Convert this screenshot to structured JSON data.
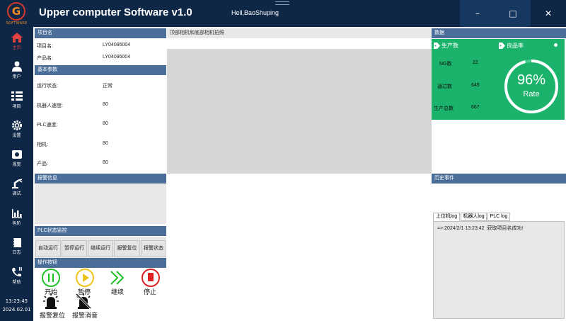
{
  "sidebar": {
    "logo_letter": "G",
    "logo_text": "SOFTWARE",
    "items": [
      {
        "label": "主页",
        "icon": "home-icon"
      },
      {
        "label": "用户",
        "icon": "user-icon"
      },
      {
        "label": "项目",
        "icon": "list-icon"
      },
      {
        "label": "设置",
        "icon": "gear-icon"
      },
      {
        "label": "视觉",
        "icon": "camera-icon"
      },
      {
        "label": "调试",
        "icon": "robot-arm-icon"
      },
      {
        "label": "色阶",
        "icon": "bar-chart-icon"
      },
      {
        "label": "日志",
        "icon": "log-icon"
      },
      {
        "label": "帮助",
        "icon": "phone-icon"
      }
    ],
    "time": "13:23:45",
    "date": "2024.02.01"
  },
  "titlebar": {
    "title": "Upper computer Software v1.0",
    "user": "Hell,BaoShuping",
    "min_label": "–",
    "max_label": "□",
    "close_label": "✕"
  },
  "project": {
    "header": "项目名",
    "rows": [
      {
        "label": "项目名:",
        "value": "LY04095004"
      },
      {
        "label": "产品名:",
        "value": "LY04095004"
      }
    ]
  },
  "params": {
    "header": "基本参数",
    "rows": [
      {
        "label": "运行状态:",
        "value": "正常"
      },
      {
        "label": "机器人速度:",
        "value": "80"
      },
      {
        "label": "PLC速度:",
        "value": "80"
      },
      {
        "label": "相机:",
        "value": "80"
      },
      {
        "label": "产品:",
        "value": "80"
      }
    ]
  },
  "alarm": {
    "header": "报警信息"
  },
  "plc": {
    "header": "PLC状态监控",
    "buttons": [
      "自动运行",
      "暂停运行",
      "继续运行",
      "报警复位",
      "报警状态"
    ]
  },
  "ops": {
    "header": "操作按钮",
    "buttons": [
      {
        "label": "开始",
        "icon": "pause-circle-icon",
        "color": "#22c02a"
      },
      {
        "label": "暂停",
        "icon": "play-circle-icon",
        "color": "#f0c419"
      },
      {
        "label": "继续",
        "icon": "double-chevron-icon",
        "color": "#22c02a"
      },
      {
        "label": "停止",
        "icon": "stop-circle-icon",
        "color": "#e02020"
      },
      {
        "label": "报警复位",
        "icon": "alarm-icon"
      },
      {
        "label": "报警消音",
        "icon": "alarm-mute-icon"
      }
    ]
  },
  "center": {
    "header": "顶部相机和底部相机拍照"
  },
  "stats": {
    "header": "数据",
    "production_title": "生产数",
    "yield_title": "良品率",
    "rows": [
      {
        "label": "NG数",
        "value": "22"
      },
      {
        "label": "通过数",
        "value": "645"
      },
      {
        "label": "生产总数",
        "value": "667"
      }
    ],
    "rate_value": "96%",
    "rate_fraction": 0.96,
    "rate_label": "Rate",
    "accent": "#1bb36b"
  },
  "history": {
    "header": "历史事件",
    "tabs": [
      "上位机log",
      "机器人log",
      "PLC log"
    ],
    "log_lines": [
      "=>:2024/2/1 13:23:42  获取项目名成功!"
    ]
  }
}
